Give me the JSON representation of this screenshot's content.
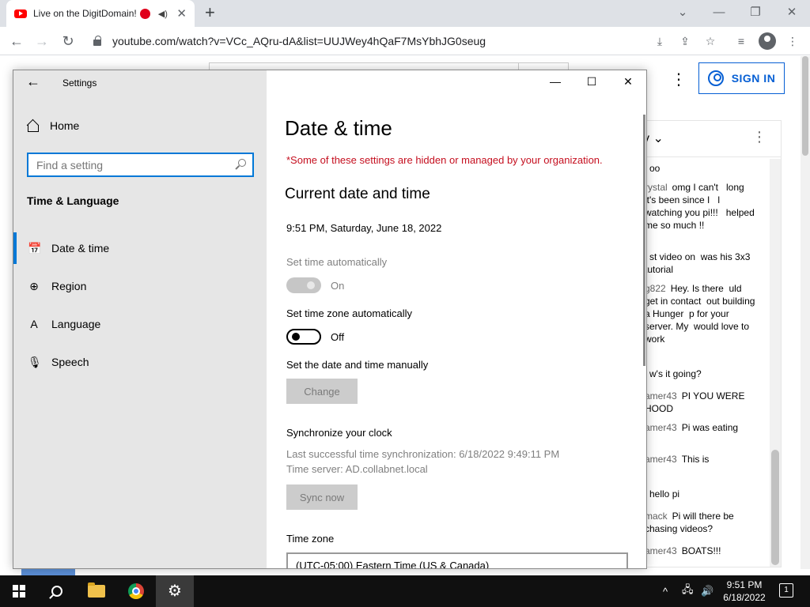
{
  "browser": {
    "tab_title": "Live on the DigitDomain!",
    "url": "youtube.com/watch?v=VCc_AQru-dA&list=UUJWey4hQaF7MsYbhJG0seug",
    "icons": [
      "youtube-favicon",
      "record-dot",
      "speaker-icon",
      "close-icon",
      "plus-icon",
      "back-icon",
      "forward-icon",
      "reload-icon",
      "lock-icon",
      "install-icon",
      "share-icon",
      "star-icon",
      "media-icon",
      "profile-icon",
      "more-icon"
    ]
  },
  "youtube": {
    "signin_label": "SIGN IN",
    "chat_messages": [
      {
        "author": "",
        "text": "oo"
      },
      {
        "author": "rystal",
        "text": "omg I can't   long it's been since I   l watching you pi!!!   helped me so much !!"
      },
      {
        "author": "",
        "text": "st video on  was his 3x3 tutorial"
      },
      {
        "author": "g822",
        "text": "Hey. Is there  uld get in contact  out building a Hunger  p for your server. My  would love to work"
      },
      {
        "author": "",
        "text": "w's it going?"
      },
      {
        "author": "amer43",
        "text": "PI YOU WERE HOOD"
      },
      {
        "author": "amer43",
        "text": "Pi was eating"
      },
      {
        "author": "amer43",
        "text": "This is"
      },
      {
        "author": "",
        "text": "hello pi"
      },
      {
        "author": "mack",
        "text": "Pi will there be  chasing videos?"
      },
      {
        "author": "amer43",
        "text": "BOATS!!!"
      }
    ]
  },
  "settings": {
    "app_title": "Settings",
    "home_label": "Home",
    "search_placeholder": "Find a setting",
    "section_label": "Time & Language",
    "nav": [
      {
        "label": "Date & time",
        "icon": "date-time-icon",
        "active": true
      },
      {
        "label": "Region",
        "icon": "globe-icon",
        "active": false
      },
      {
        "label": "Language",
        "icon": "language-icon",
        "active": false
      },
      {
        "label": "Speech",
        "icon": "microphone-icon",
        "active": false
      }
    ],
    "page_title": "Date & time",
    "warning": "*Some of these settings are hidden or managed by your organization.",
    "current_heading": "Current date and time",
    "current_value": "9:51 PM, Saturday, June 18, 2022",
    "set_time_auto_label": "Set time automatically",
    "set_time_auto_state": "On",
    "set_tz_auto_label": "Set time zone automatically",
    "set_tz_auto_state": "Off",
    "manual_label": "Set the date and time manually",
    "change_button": "Change",
    "sync_heading": "Synchronize your clock",
    "sync_last": "Last successful time synchronization: 6/18/2022 9:49:11 PM",
    "sync_server": "Time server: AD.collabnet.local",
    "sync_button": "Sync now",
    "timezone_label": "Time zone",
    "timezone_value": "(UTC-05:00) Eastern Time (US & Canada)"
  },
  "taskbar": {
    "time": "9:51 PM",
    "date": "6/18/2022",
    "notification_count": "1"
  }
}
